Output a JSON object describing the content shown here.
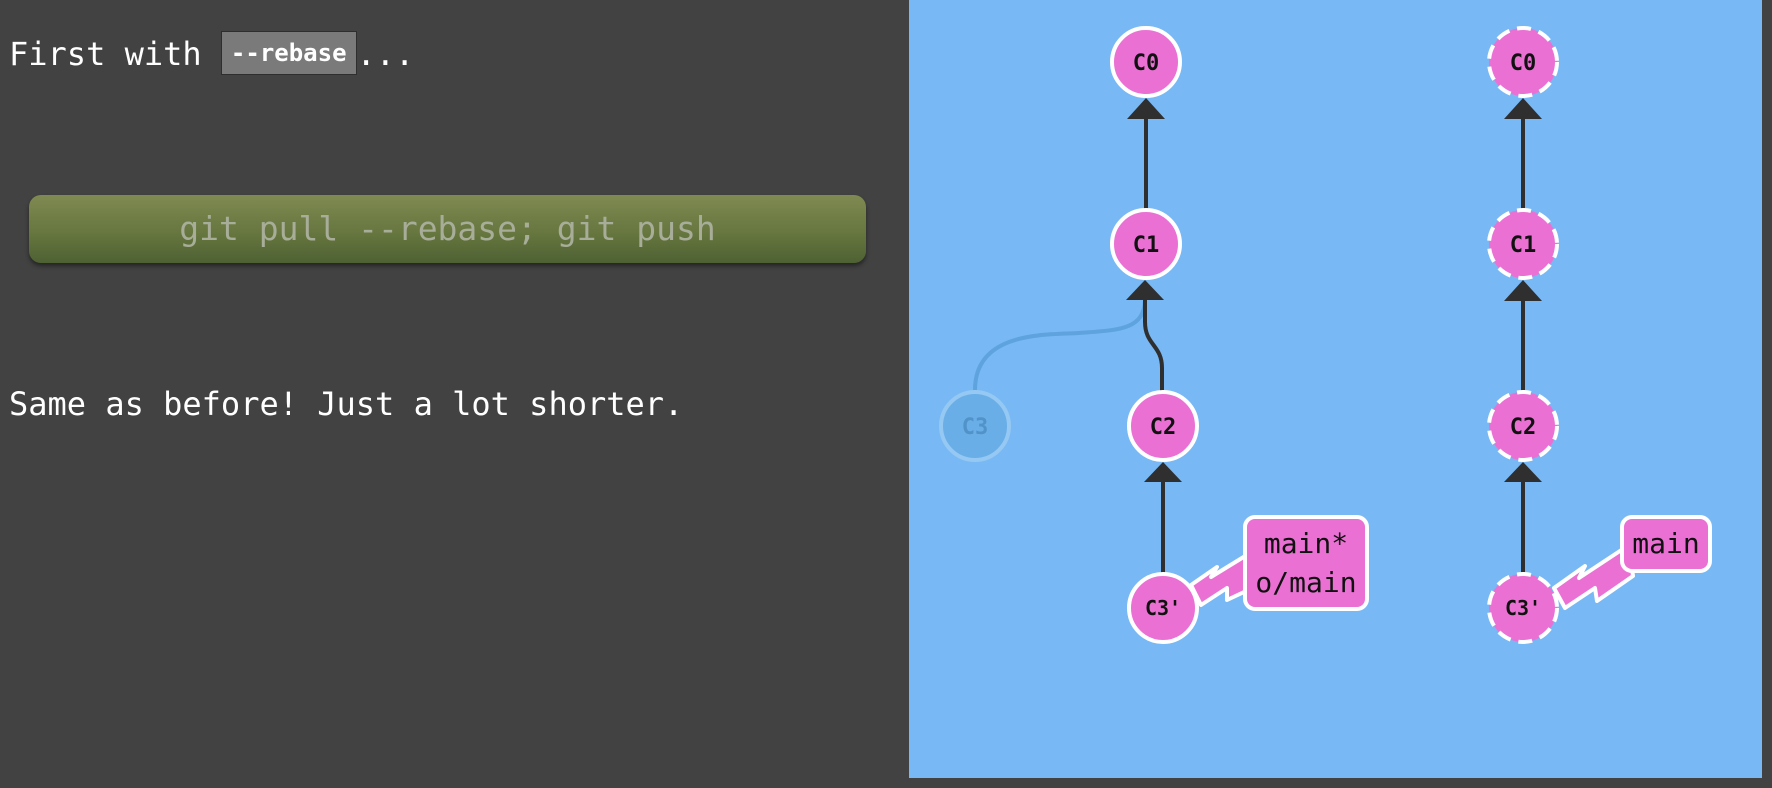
{
  "instruction": {
    "intro_prefix": "First with ",
    "intro_code": "--rebase",
    "intro_suffix": "...",
    "command": "git pull --rebase; git push",
    "summary": "Same as before! Just a lot shorter."
  },
  "local_tree": {
    "commits": [
      "C0",
      "C1",
      "C2",
      "C3'"
    ],
    "ghost_commit": "C3",
    "branch_labels": [
      "main*",
      "o/main"
    ]
  },
  "remote_tree": {
    "commits": [
      "C0",
      "C1",
      "C2",
      "C3'"
    ],
    "branch_labels": [
      "main"
    ]
  },
  "colors": {
    "background": "#424242",
    "viz_background": "#77b8f5",
    "commit_fill": "#ea71d3",
    "command_button": "#6b7a42"
  }
}
